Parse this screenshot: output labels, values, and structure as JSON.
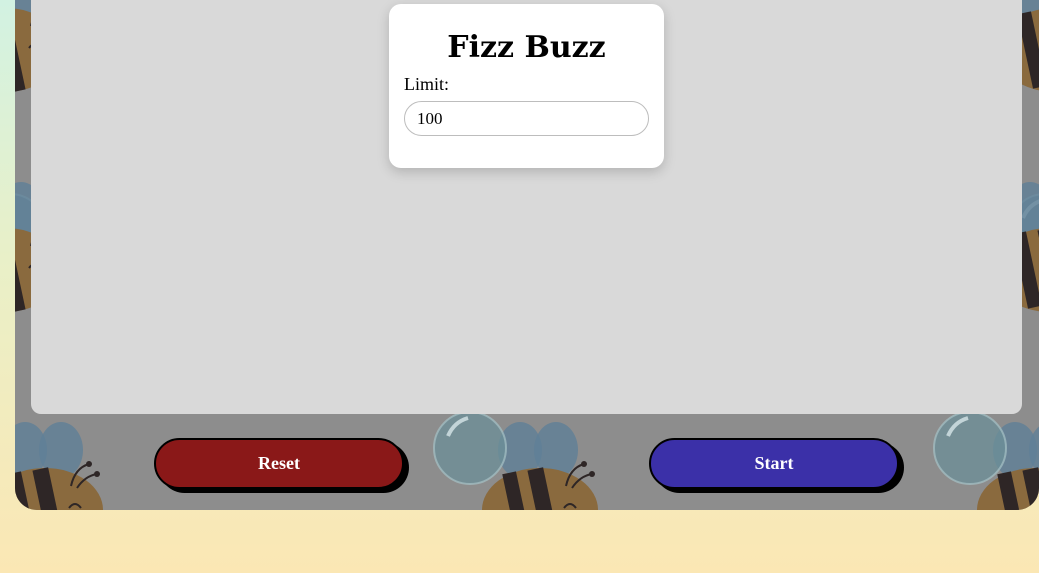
{
  "app": {
    "title": "Fizz Buzz"
  },
  "form": {
    "limit_label": "Limit:",
    "limit_value": "100"
  },
  "buttons": {
    "reset_label": "Reset",
    "start_label": "Start"
  },
  "colors": {
    "reset_button": "#8a1818",
    "start_button": "#3b30a8",
    "panel": "#d9d9d9",
    "frame": "#8d8d8d"
  },
  "decor": {
    "background_pattern": "bee-and-bubble-icons"
  }
}
